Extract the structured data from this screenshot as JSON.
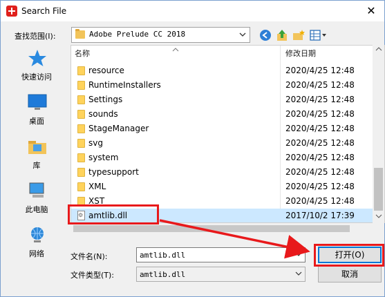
{
  "window": {
    "title": "Search File",
    "close_glyph": "✕"
  },
  "lookin": {
    "label": "查找范围(I):",
    "value": "Adobe Prelude CC 2018"
  },
  "toolbar": {
    "icons": [
      "back-icon",
      "up-folder-icon",
      "new-folder-icon",
      "view-menu-icon"
    ]
  },
  "places": [
    {
      "label": "快速访问",
      "icon": "quick-access-icon"
    },
    {
      "label": "桌面",
      "icon": "desktop-icon"
    },
    {
      "label": "库",
      "icon": "library-icon"
    },
    {
      "label": "此电脑",
      "icon": "this-pc-icon"
    },
    {
      "label": "网络",
      "icon": "network-icon"
    }
  ],
  "filelist": {
    "columns": {
      "name": "名称",
      "date": "修改日期"
    },
    "rows": [
      {
        "name": "resource",
        "date": "2020/4/25 12:48",
        "type": "folder"
      },
      {
        "name": "RuntimeInstallers",
        "date": "2020/4/25 12:48",
        "type": "folder"
      },
      {
        "name": "Settings",
        "date": "2020/4/25 12:48",
        "type": "folder"
      },
      {
        "name": "sounds",
        "date": "2020/4/25 12:48",
        "type": "folder"
      },
      {
        "name": "StageManager",
        "date": "2020/4/25 12:48",
        "type": "folder"
      },
      {
        "name": "svg",
        "date": "2020/4/25 12:48",
        "type": "folder"
      },
      {
        "name": "system",
        "date": "2020/4/25 12:48",
        "type": "folder"
      },
      {
        "name": "typesupport",
        "date": "2020/4/25 12:48",
        "type": "folder"
      },
      {
        "name": "XML",
        "date": "2020/4/25 12:48",
        "type": "folder"
      },
      {
        "name": "XST",
        "date": "2020/4/25 12:48",
        "type": "folder"
      },
      {
        "name": "amtlib.dll",
        "date": "2017/10/2 17:39",
        "type": "file",
        "selected": true
      }
    ]
  },
  "filename": {
    "label": "文件名(N):",
    "value": "amtlib.dll"
  },
  "filetype": {
    "label": "文件类型(T):",
    "value": "amtlib.dll"
  },
  "buttons": {
    "open": "打开(O)",
    "cancel": "取消"
  },
  "colors": {
    "annotation": "#e8191b",
    "selection": "#cce8ff",
    "accent": "#0078d7"
  }
}
